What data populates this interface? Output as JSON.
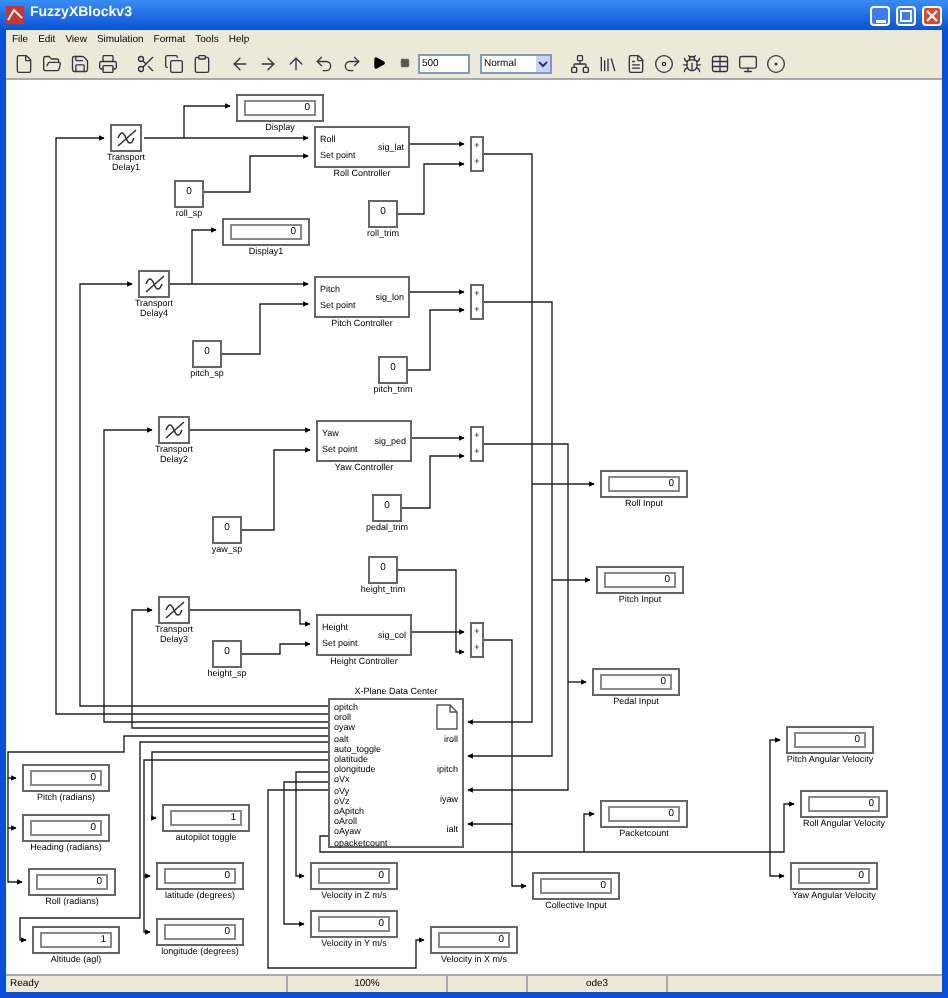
{
  "window": {
    "title": "FuzzyXBlockv3"
  },
  "menu": [
    "File",
    "Edit",
    "View",
    "Simulation",
    "Format",
    "Tools",
    "Help"
  ],
  "toolbar": {
    "stop_time": "500",
    "mode": "Normal"
  },
  "blocks": [
    {
      "kind": "display",
      "value": "0",
      "label": "Display"
    },
    {
      "kind": "delay",
      "label": "Transport Delay1"
    },
    {
      "kind": "controller",
      "inputs": [
        "Roll",
        "Set point"
      ],
      "output": "sig_lat",
      "label": "Roll Controller"
    },
    {
      "kind": "sum",
      "signs": [
        "+",
        "+"
      ]
    },
    {
      "kind": "const",
      "value": "0",
      "label": "roll_sp"
    },
    {
      "kind": "const",
      "value": "0",
      "label": "roll_trim"
    },
    {
      "kind": "display",
      "value": "0",
      "label": "Display1"
    },
    {
      "kind": "delay",
      "label": "Transport Delay4"
    },
    {
      "kind": "controller",
      "inputs": [
        "Pitch",
        "Set point"
      ],
      "output": "sig_lon",
      "label": "Pitch Controller"
    },
    {
      "kind": "sum",
      "signs": [
        "+",
        "+"
      ]
    },
    {
      "kind": "const",
      "value": "0",
      "label": "pitch_sp"
    },
    {
      "kind": "const",
      "value": "0",
      "label": "pitch_trim"
    },
    {
      "kind": "delay",
      "label": "Transport Delay2"
    },
    {
      "kind": "controller",
      "inputs": [
        "Yaw",
        "Set point"
      ],
      "output": "sig_ped",
      "label": "Yaw Controller"
    },
    {
      "kind": "sum",
      "signs": [
        "+",
        "+"
      ]
    },
    {
      "kind": "display",
      "value": "0",
      "label": "Roll Input"
    },
    {
      "kind": "const",
      "value": "0",
      "label": "pedal_trim"
    },
    {
      "kind": "const",
      "value": "0",
      "label": "yaw_sp"
    },
    {
      "kind": "const",
      "value": "0",
      "label": "height_trim"
    },
    {
      "kind": "display",
      "value": "0",
      "label": "Pitch Input"
    },
    {
      "kind": "delay",
      "label": "Transport Delay3"
    },
    {
      "kind": "controller",
      "inputs": [
        "Height",
        "Set point"
      ],
      "output": "sig_col",
      "label": "Height Controller"
    },
    {
      "kind": "sum",
      "signs": [
        "+",
        "+"
      ]
    },
    {
      "kind": "const",
      "value": "0",
      "label": "height_sp"
    },
    {
      "kind": "datacenter",
      "label": "X-Plane Data Center",
      "outputs": [
        "opitch",
        "oroll",
        "oyaw",
        "oalt",
        "auto_toggle",
        "olatitude",
        "olongitude",
        "oVx",
        "oVy",
        "oVz",
        "oApitch",
        "oAroll",
        "oAyaw",
        "opacketcount"
      ],
      "inputs": [
        "iroll",
        "ipitch",
        "iyaw",
        "ialt"
      ]
    },
    {
      "kind": "display",
      "value": "0",
      "label": "Pedal Input"
    },
    {
      "kind": "display",
      "value": "0",
      "label": "Pitch Angular Velocity"
    },
    {
      "kind": "display",
      "value": "0",
      "label": "Pitch (radians)"
    },
    {
      "kind": "display",
      "value": "0",
      "label": "Heading (radians)"
    },
    {
      "kind": "display",
      "value": "1",
      "label": "autopilot toggle"
    },
    {
      "kind": "display",
      "value": "0",
      "label": "Packetcount"
    },
    {
      "kind": "display",
      "value": "0",
      "label": "Roll Angular Velocity"
    },
    {
      "kind": "display",
      "value": "0",
      "label": "Roll (radians)"
    },
    {
      "kind": "display",
      "value": "0",
      "label": "latitude (degrees)"
    },
    {
      "kind": "display",
      "value": "0",
      "label": "Velocity in Z m/s"
    },
    {
      "kind": "display",
      "value": "0",
      "label": "Collective Input"
    },
    {
      "kind": "display",
      "value": "0",
      "label": "Yaw Angular Velocity"
    },
    {
      "kind": "display",
      "value": "1",
      "label": "Altitude (agl)"
    },
    {
      "kind": "display",
      "value": "0",
      "label": "longitude (degrees)"
    },
    {
      "kind": "display",
      "value": "0",
      "label": "Velocity in Y m/s"
    },
    {
      "kind": "display",
      "value": "0",
      "label": "Velocity in X m/s"
    }
  ],
  "status_bar": {
    "state": "Ready",
    "zoom": "100%",
    "solver": "ode3"
  }
}
